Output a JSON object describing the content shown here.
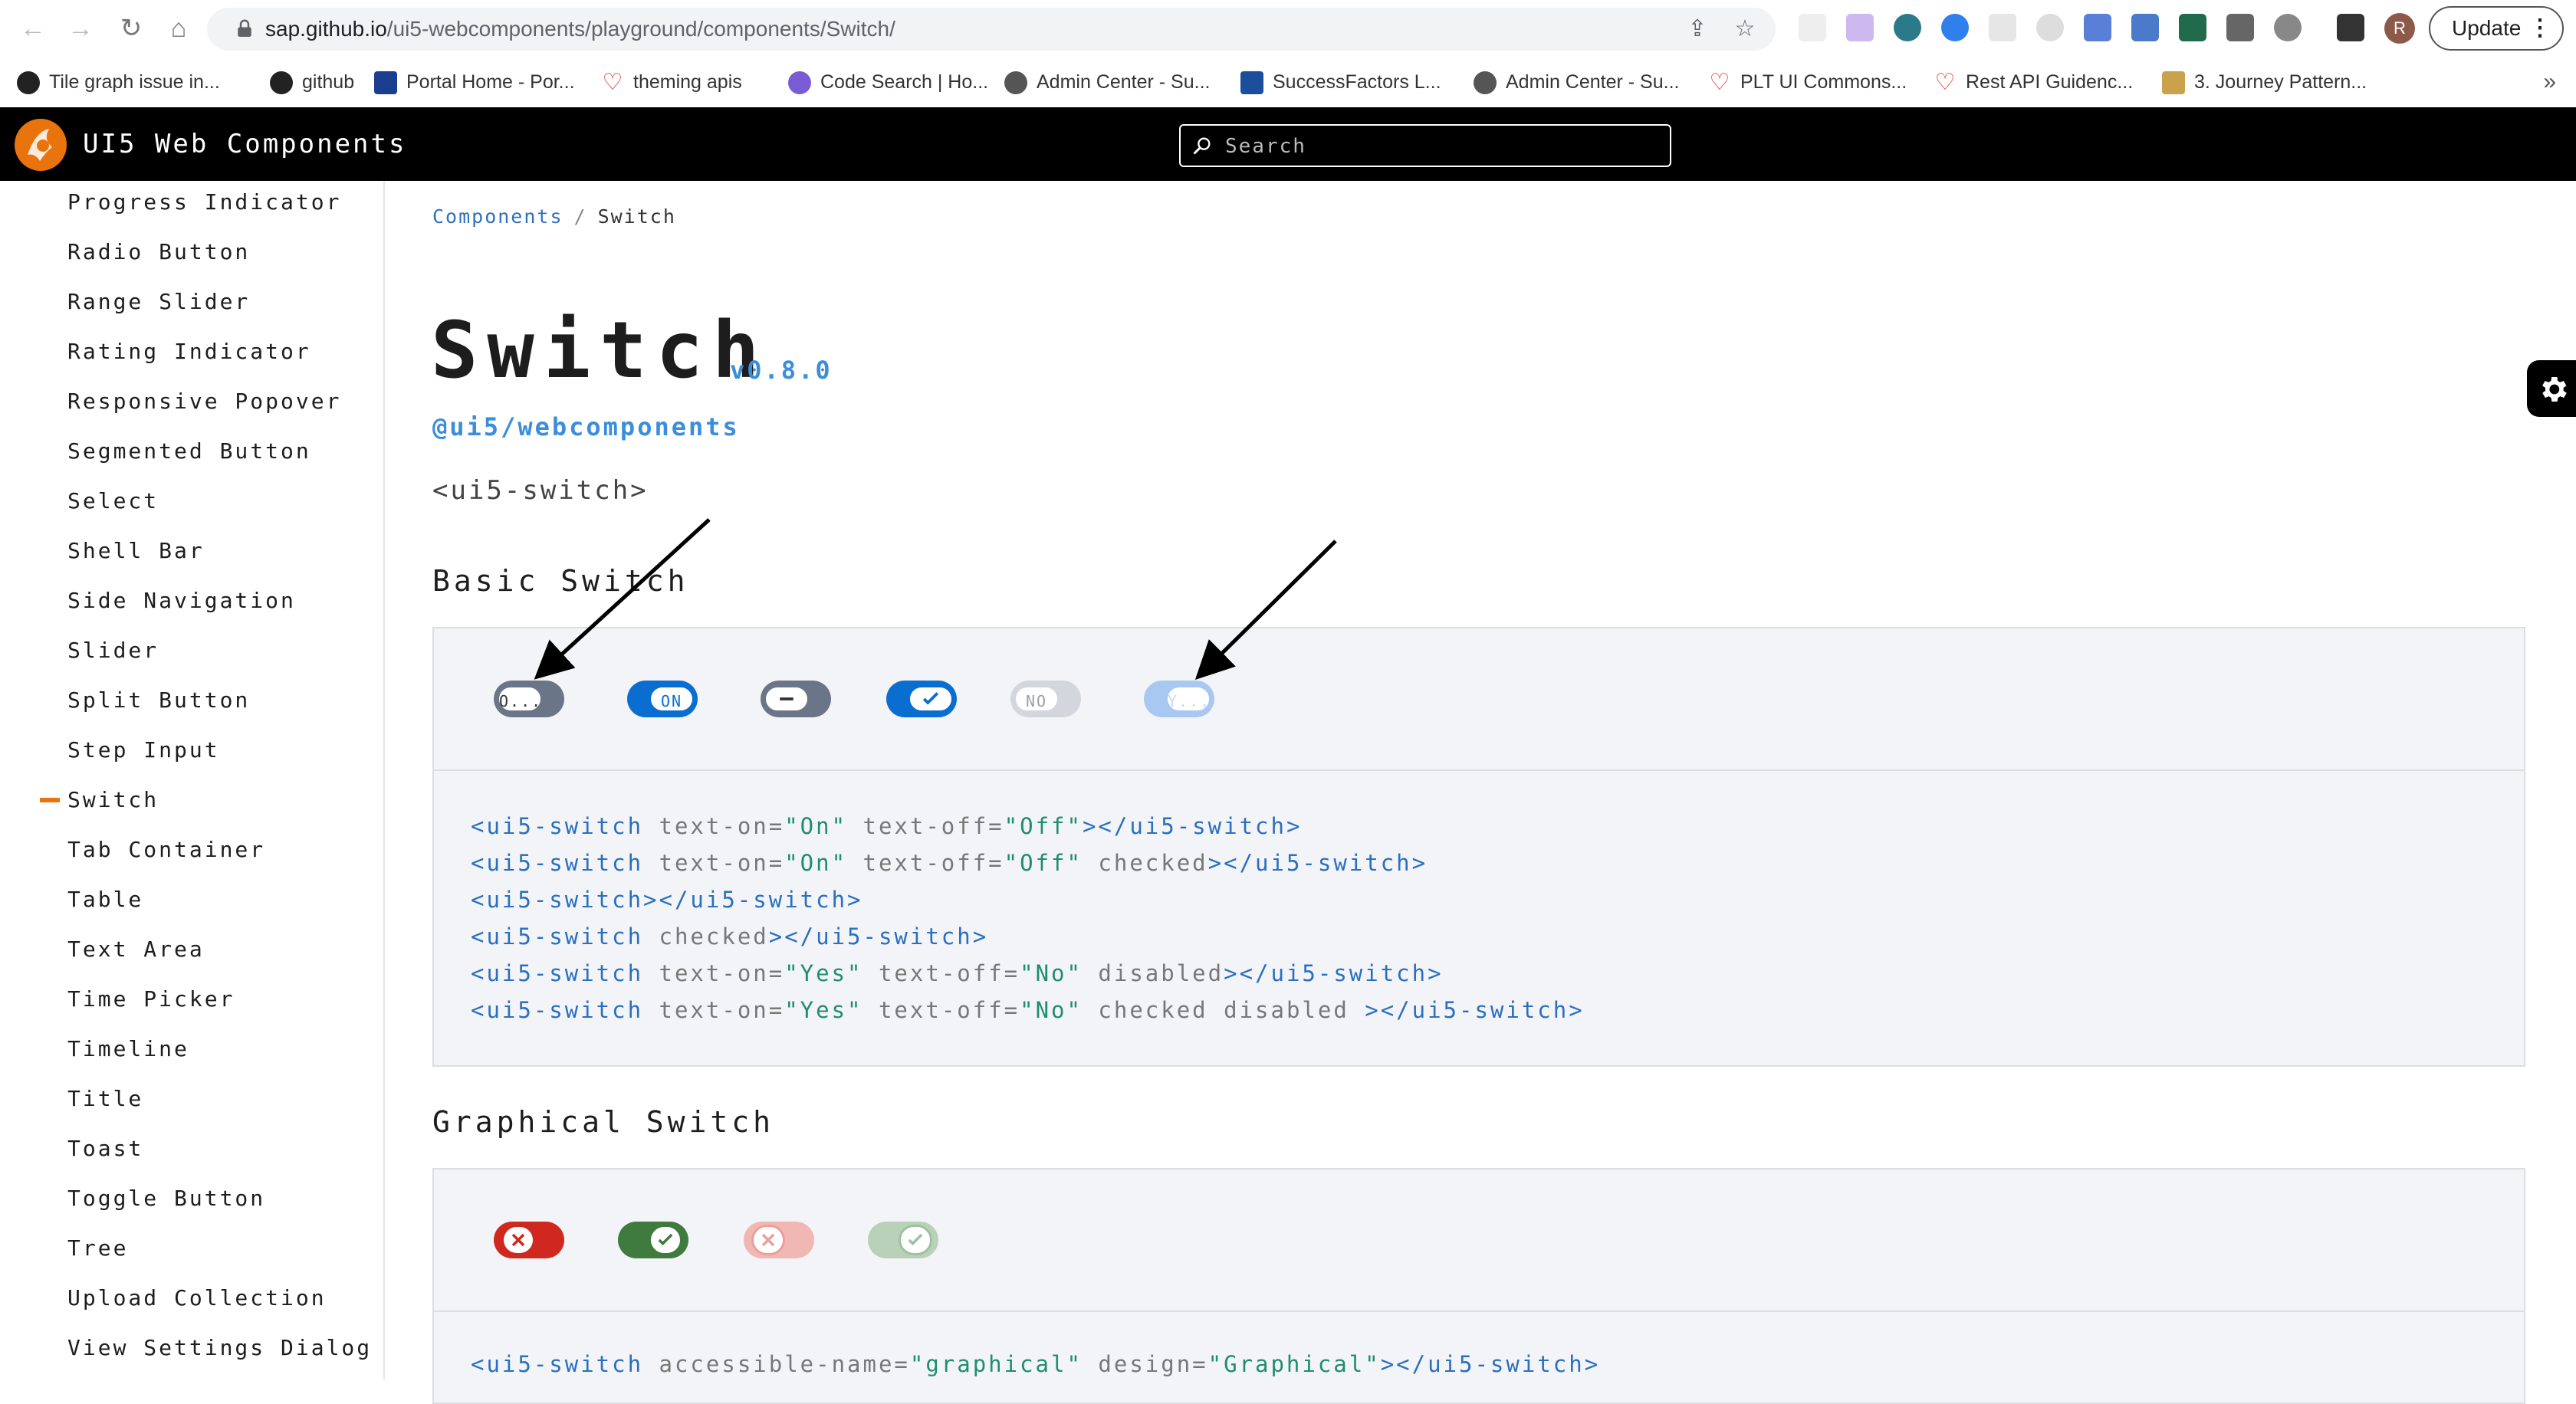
{
  "browser": {
    "url_host": "sap.github.io",
    "url_path": "/ui5-webcomponents/playground/components/Switch/",
    "update_label": "Update",
    "profile_initial": "R",
    "bookmarks": [
      {
        "label": "Tile graph issue in...",
        "icon": "github-icon"
      },
      {
        "label": "github",
        "icon": "github-icon"
      },
      {
        "label": "Portal Home - Por...",
        "icon": "sap-icon"
      },
      {
        "label": "theming apis",
        "icon": "heart-icon"
      },
      {
        "label": "Code Search | Ho...",
        "icon": "star-icon"
      },
      {
        "label": "Admin Center - Su...",
        "icon": "globe-icon"
      },
      {
        "label": "SuccessFactors L...",
        "icon": "sf-icon"
      },
      {
        "label": "Admin Center - Su...",
        "icon": "globe-icon"
      },
      {
        "label": "PLT UI Commons...",
        "icon": "heart-icon"
      },
      {
        "label": "Rest API Guidenc...",
        "icon": "heart-icon"
      },
      {
        "label": "3. Journey Pattern...",
        "icon": "book-icon"
      }
    ]
  },
  "header": {
    "title": "UI5 Web Components",
    "search_placeholder": "Search"
  },
  "sidebar": {
    "items": [
      "Progress Indicator",
      "Radio Button",
      "Range Slider",
      "Rating Indicator",
      "Responsive Popover",
      "Segmented Button",
      "Select",
      "Shell Bar",
      "Side Navigation",
      "Slider",
      "Split Button",
      "Step Input",
      "Switch",
      "Tab Container",
      "Table",
      "Text Area",
      "Time Picker",
      "Timeline",
      "Title",
      "Toast",
      "Toggle Button",
      "Tree",
      "Upload Collection",
      "View Settings Dialog"
    ],
    "active": "Switch"
  },
  "breadcrumb": {
    "parent": "Components",
    "separator": "/",
    "current": "Switch"
  },
  "page": {
    "title": "Switch",
    "version": "v0.8.0",
    "package": "@ui5/webcomponents",
    "tag": "<ui5-switch>"
  },
  "basic": {
    "title": "Basic Switch",
    "switches": [
      {
        "text": "O...",
        "state": "off"
      },
      {
        "text": "ON",
        "state": "on"
      },
      {
        "text": "",
        "state": "off-icon"
      },
      {
        "text": "",
        "state": "on-icon"
      },
      {
        "text": "NO",
        "state": "disabled-off"
      },
      {
        "text": "Y...",
        "state": "disabled-on"
      }
    ],
    "code": [
      [
        [
          "tg",
          "<ui5-switch "
        ],
        [
          "at",
          "text-on="
        ],
        [
          "vl",
          "\"On\""
        ],
        [
          "at",
          " text-off="
        ],
        [
          "vl",
          "\"Off\""
        ],
        [
          "tg",
          "></ui5-switch>"
        ]
      ],
      [
        [
          "tg",
          "<ui5-switch "
        ],
        [
          "at",
          "text-on="
        ],
        [
          "vl",
          "\"On\""
        ],
        [
          "at",
          " text-off="
        ],
        [
          "vl",
          "\"Off\""
        ],
        [
          "at",
          " checked"
        ],
        [
          "tg",
          "></ui5-switch>"
        ]
      ],
      [
        [
          "tg",
          "<ui5-switch></ui5-switch>"
        ]
      ],
      [
        [
          "tg",
          "<ui5-switch "
        ],
        [
          "at",
          "checked"
        ],
        [
          "tg",
          "></ui5-switch>"
        ]
      ],
      [
        [
          "tg",
          "<ui5-switch "
        ],
        [
          "at",
          "text-on="
        ],
        [
          "vl",
          "\"Yes\""
        ],
        [
          "at",
          " text-off="
        ],
        [
          "vl",
          "\"No\""
        ],
        [
          "at",
          " disabled"
        ],
        [
          "tg",
          "></ui5-switch>"
        ]
      ],
      [
        [
          "tg",
          "<ui5-switch "
        ],
        [
          "at",
          "text-on="
        ],
        [
          "vl",
          "\"Yes\""
        ],
        [
          "at",
          " text-off="
        ],
        [
          "vl",
          "\"No\""
        ],
        [
          "at",
          " checked disabled "
        ],
        [
          "tg",
          "></ui5-switch>"
        ]
      ]
    ]
  },
  "graphical": {
    "title": "Graphical Switch",
    "switches": [
      {
        "state": "off"
      },
      {
        "state": "on"
      },
      {
        "state": "disabled-off"
      },
      {
        "state": "disabled-on"
      }
    ],
    "code": [
      [
        [
          "tg",
          "<ui5-switch "
        ],
        [
          "at",
          "accessible-name="
        ],
        [
          "vl",
          "\"graphical\""
        ],
        [
          "at",
          " design="
        ],
        [
          "vl",
          "\"Graphical\""
        ],
        [
          "tg",
          "></ui5-switch>"
        ]
      ]
    ]
  },
  "colors": {
    "accent": "#0a6ed1",
    "brand_orange": "#e9730c",
    "graphical_red": "#d0281e",
    "graphical_green": "#3f7a3f"
  }
}
